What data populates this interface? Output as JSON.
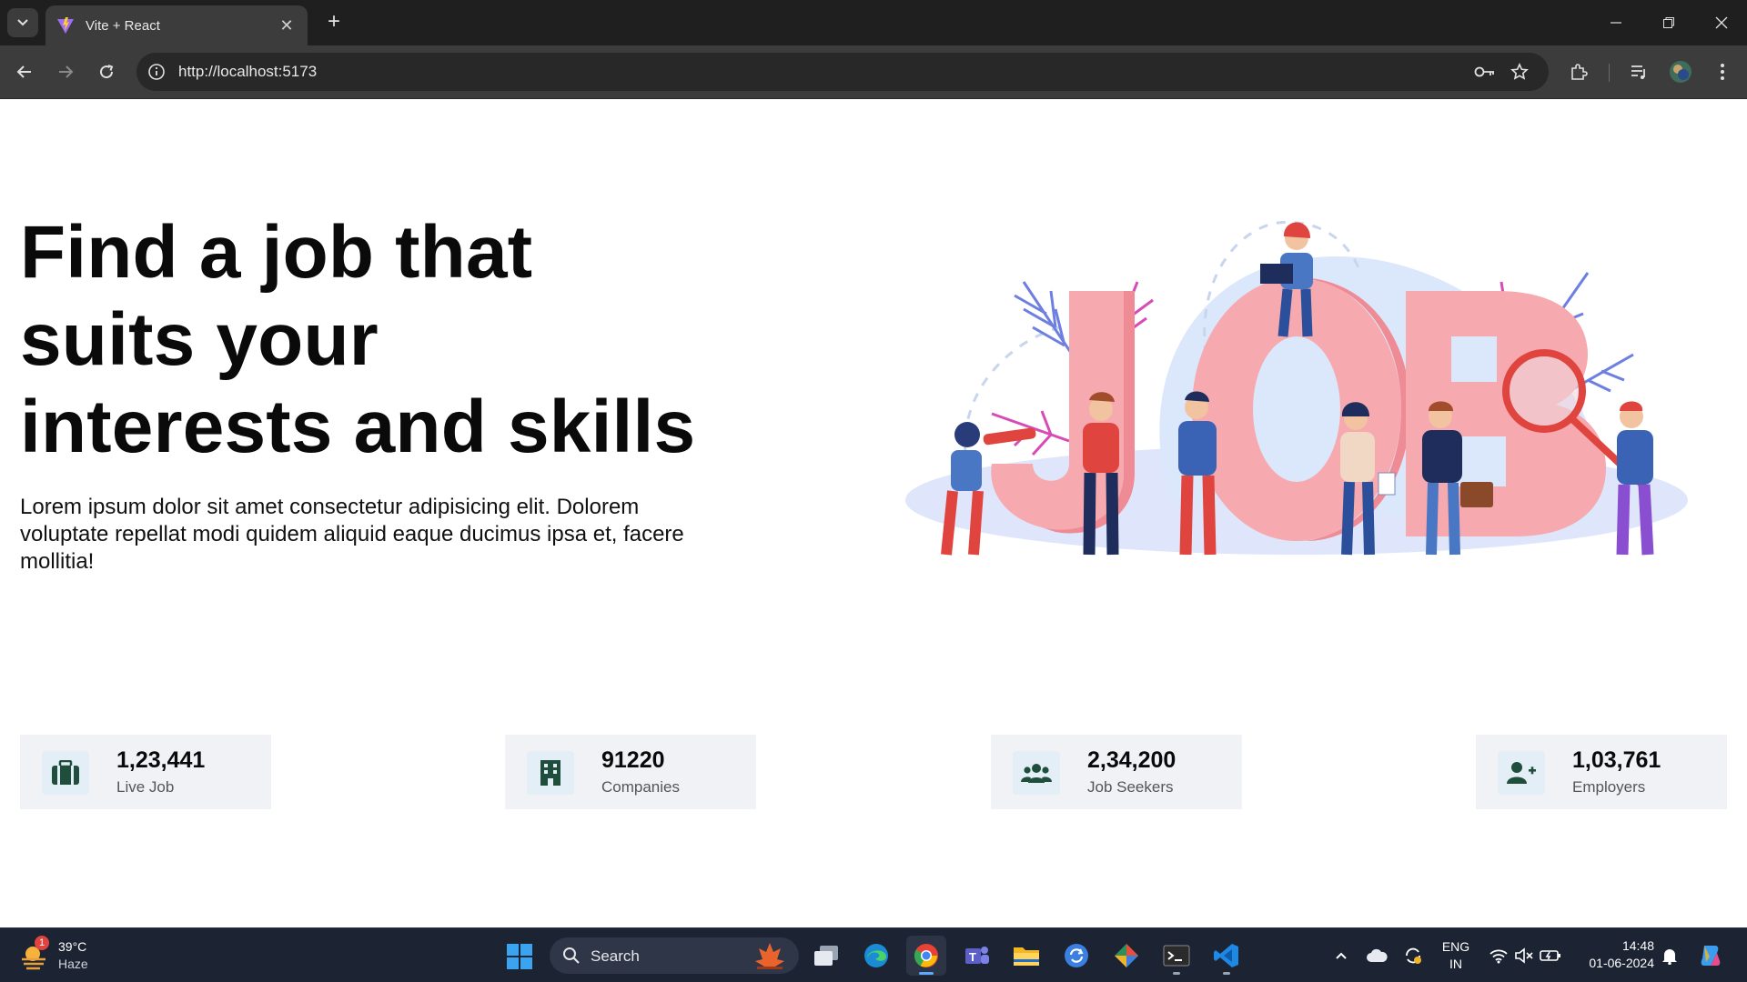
{
  "browser": {
    "tab_title": "Vite + React",
    "tab_close": "✕",
    "new_tab": "+",
    "url": "http://localhost:5173"
  },
  "hero": {
    "title": "Find a job that suits your interests and skills",
    "description": "Lorem ipsum dolor sit amet consectetur adipisicing elit. Dolorem voluptate repellat modi quidem aliquid eaque ducimus ipsa et, facere mollitia!",
    "illustration_letters": [
      "J",
      "O",
      "B"
    ]
  },
  "stats": [
    {
      "value": "1,23,441",
      "label": "Live Job",
      "icon": "briefcase-icon"
    },
    {
      "value": "91220",
      "label": "Companies",
      "icon": "building-icon"
    },
    {
      "value": "2,34,200",
      "label": "Job Seekers",
      "icon": "users-icon"
    },
    {
      "value": "1,03,761",
      "label": "Employers",
      "icon": "user-plus-icon"
    }
  ],
  "taskbar": {
    "weather_temp": "39°C",
    "weather_cond": "Haze",
    "weather_badge": "1",
    "search_label": "Search",
    "lang_line1": "ENG",
    "lang_line2": "IN",
    "time": "14:48",
    "date": "01-06-2024"
  },
  "colors": {
    "accent_icon": "#1f4e3d",
    "stat_bg": "#f1f2f6",
    "letters": "#f6a9ae"
  }
}
